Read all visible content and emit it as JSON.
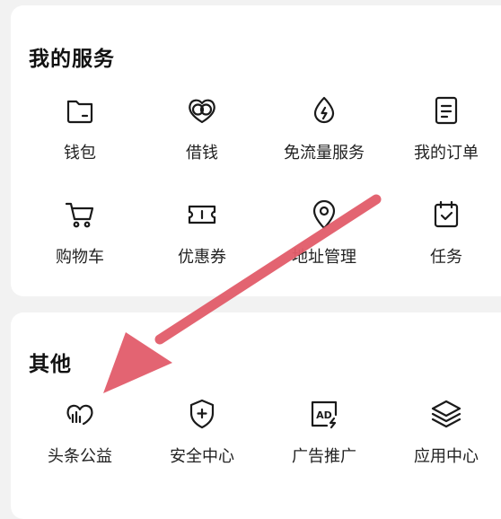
{
  "services": {
    "title": "我的服务",
    "items": [
      {
        "label": "钱包",
        "icon": "wallet-icon"
      },
      {
        "label": "借钱",
        "icon": "borrow-money-icon"
      },
      {
        "label": "免流量服务",
        "icon": "free-data-icon"
      },
      {
        "label": "我的订单",
        "icon": "orders-icon"
      },
      {
        "label": "购物车",
        "icon": "shopping-cart-icon"
      },
      {
        "label": "优惠券",
        "icon": "coupon-icon"
      },
      {
        "label": "地址管理",
        "icon": "location-pin-icon"
      },
      {
        "label": "任务",
        "icon": "calendar-task-icon"
      }
    ]
  },
  "other": {
    "title": "其他",
    "items": [
      {
        "label": "头条公益",
        "icon": "charity-heart-icon"
      },
      {
        "label": "安全中心",
        "icon": "shield-icon"
      },
      {
        "label": "广告推广",
        "icon": "ad-icon"
      },
      {
        "label": "应用中心",
        "icon": "layers-icon"
      }
    ]
  },
  "annotation": {
    "arrow_color": "#e25c6a"
  },
  "colors": {
    "background": "#f2f2f2",
    "card": "#ffffff",
    "icon_stroke": "#1a1a1a"
  }
}
